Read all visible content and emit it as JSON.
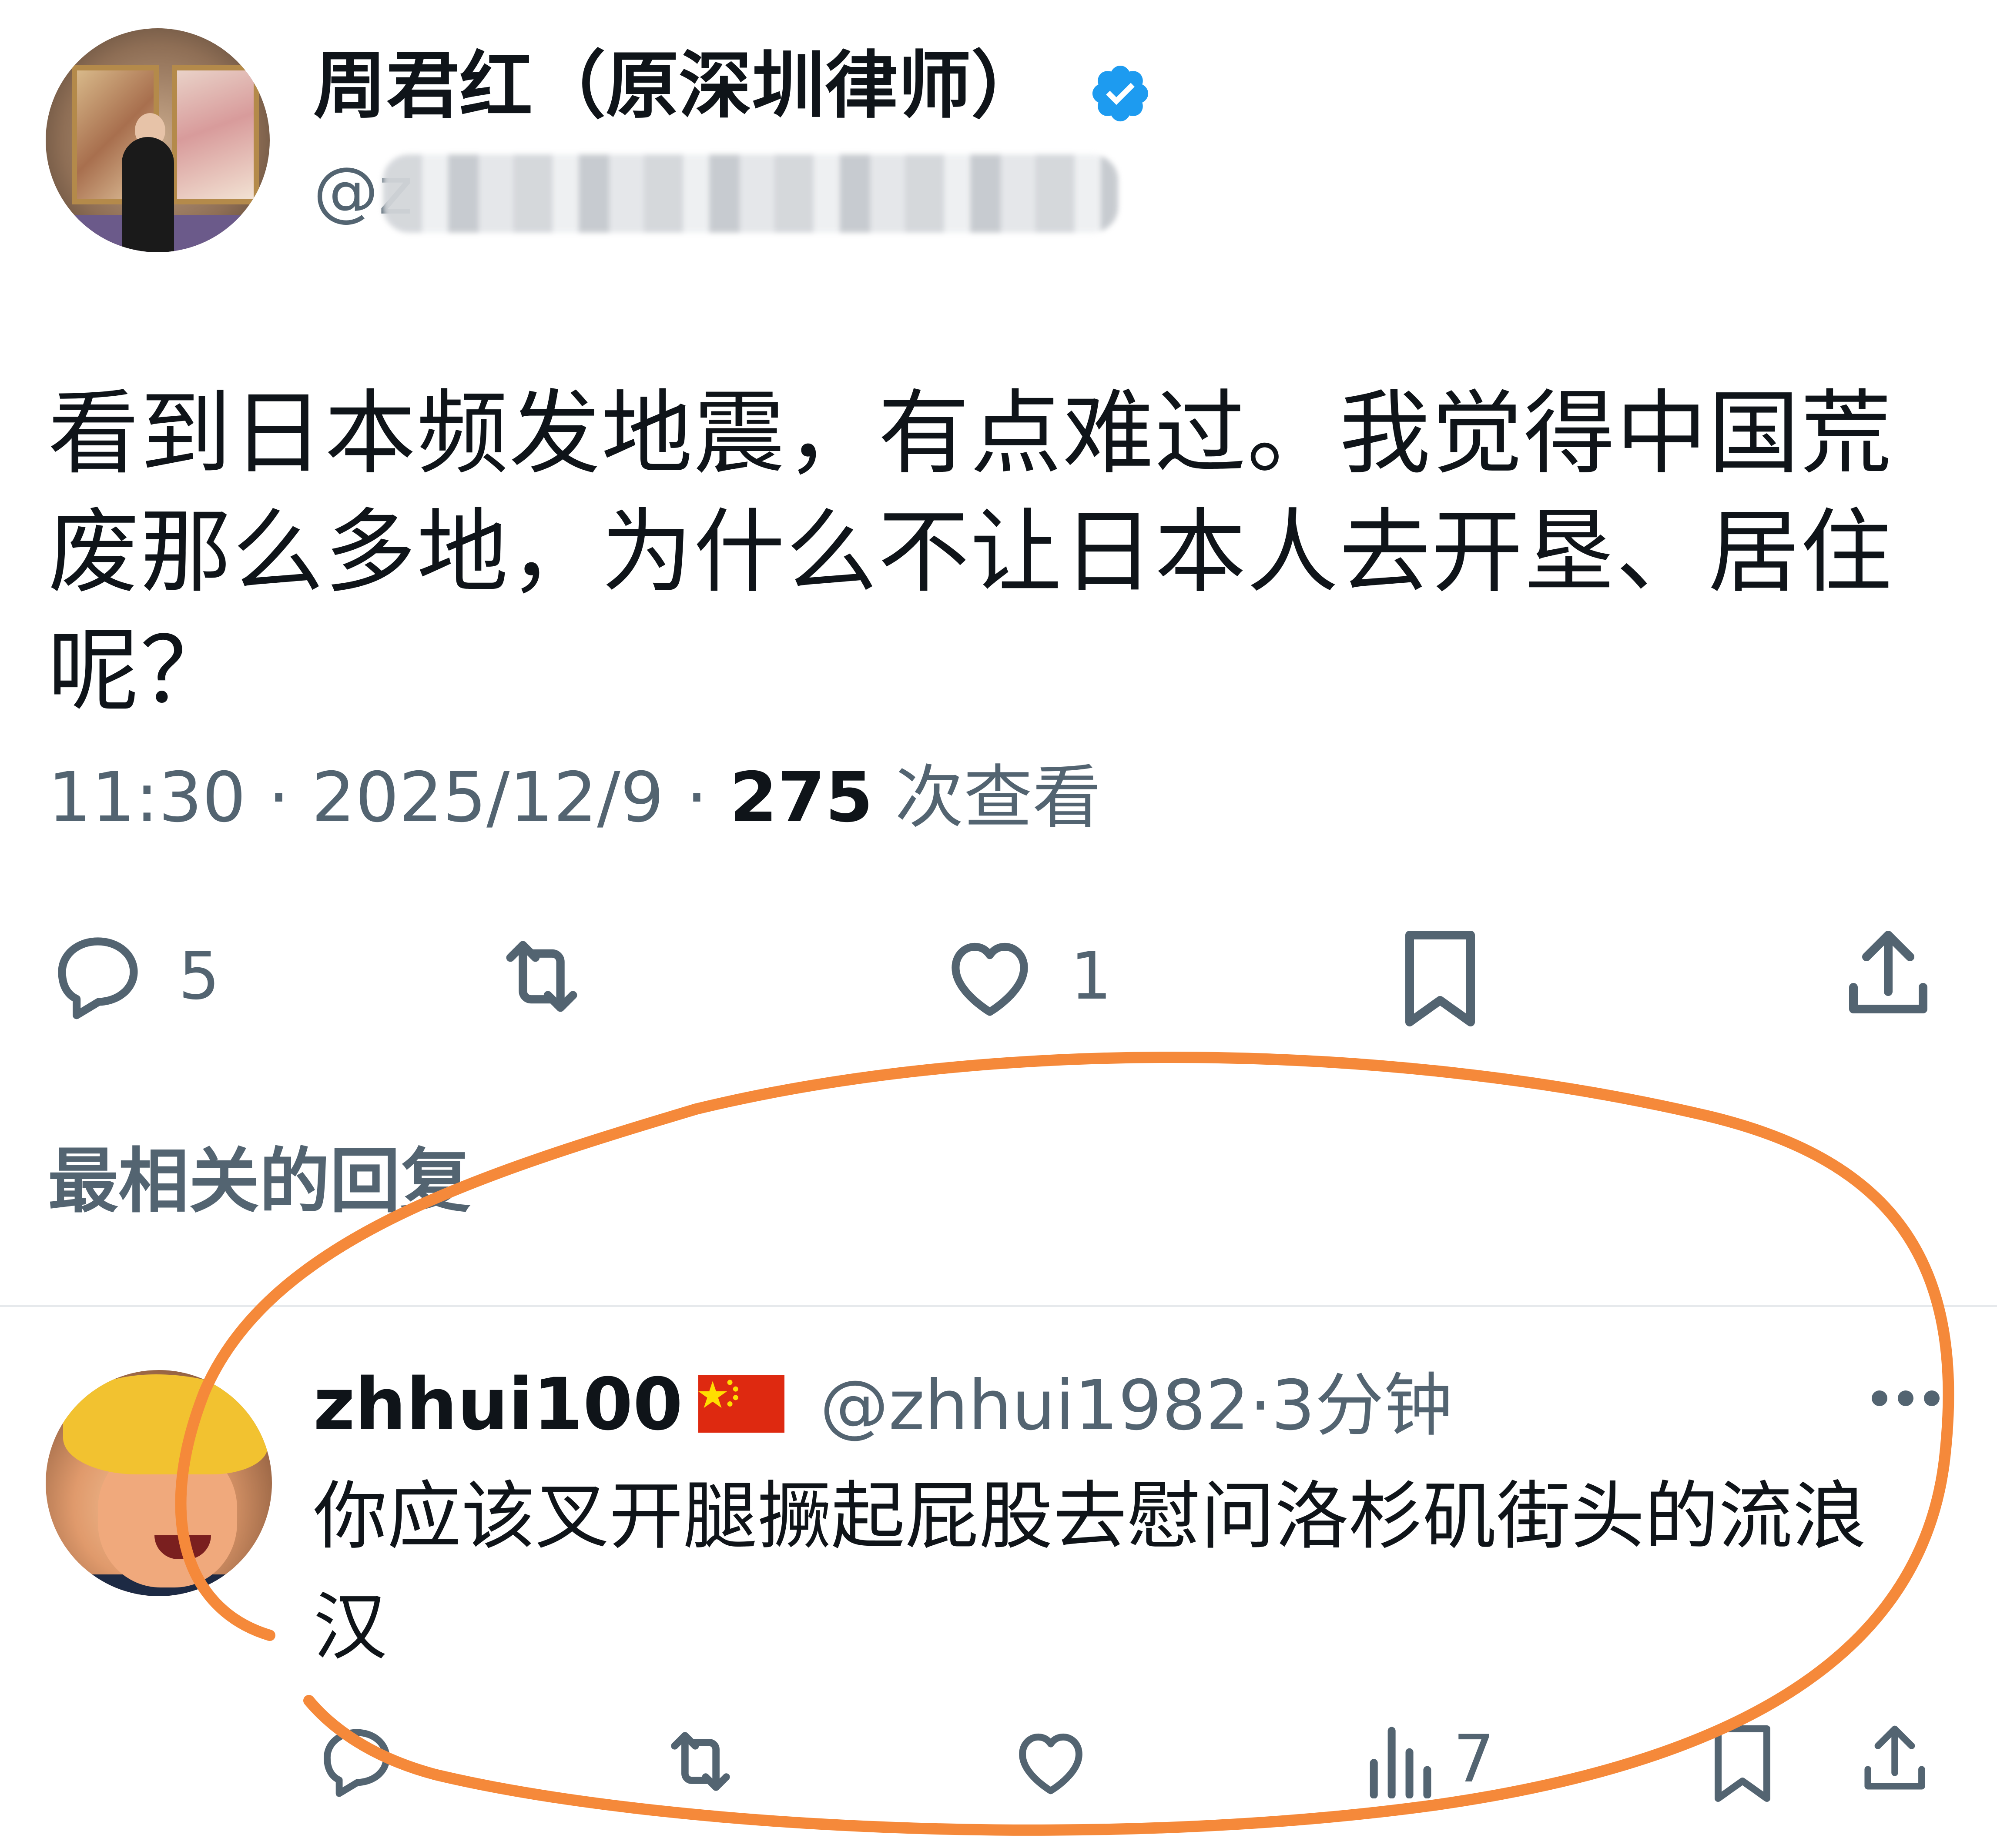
{
  "tweet": {
    "author_name": "周君红（原深圳律师）",
    "handle_prefix": "@z",
    "text": "看到日本频发地震，有点难过。我觉得中国荒废那么多地，为什么不让日本人去开垦、居住呢？",
    "time": "11:30",
    "date": "2025/12/9",
    "separator": " · ",
    "views_count": "275",
    "views_label": " 次查看",
    "reply_count": "5",
    "like_count": "1"
  },
  "replies_section": {
    "heading": "最相关的回复"
  },
  "reply": {
    "name": "zhhui100",
    "handle": "@zhhui1982",
    "time_sep": "·",
    "time_ago": "3分钟",
    "text": "你应该叉开腿撅起屁股去慰问洛杉矶街头的流浪汉",
    "views_count": "7",
    "more_glyph": "···"
  },
  "colors": {
    "accent_blue": "#1d9bf0",
    "muted_text": "#536471",
    "primary_text": "#0f1419",
    "annotation_orange": "#f5893a"
  },
  "icons": [
    "verified-badge-icon",
    "reply-icon",
    "retweet-icon",
    "like-icon",
    "bookmark-icon",
    "share-icon",
    "views-icon",
    "more-icon",
    "china-flag-icon"
  ]
}
